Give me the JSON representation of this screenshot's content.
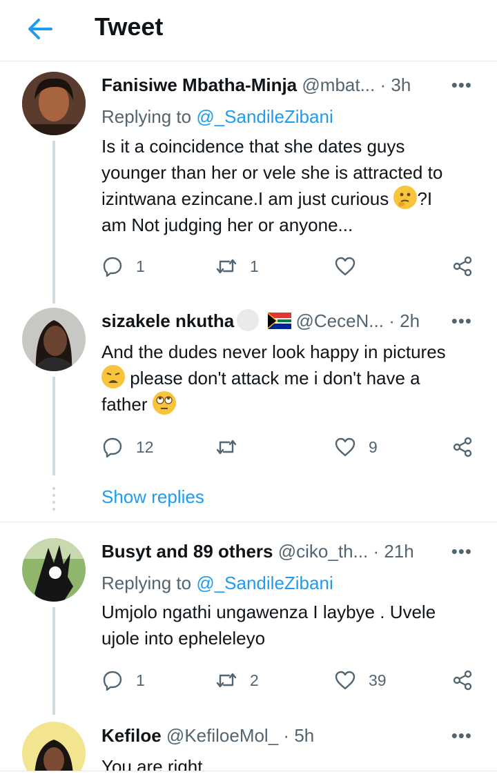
{
  "header": {
    "title": "Tweet"
  },
  "tweets": [
    {
      "name": "Fanisiwe Mbatha-Minja",
      "handle": "@mbat...",
      "time": "3h",
      "replying_prefix": "Replying to ",
      "replying_to": "@_SandileZibani",
      "text_lines": [
        "Is it a coincidence that she dates guys",
        "younger than her or vele she is attracted to",
        "izintwana ezincane.I am just curious",
        "?I",
        "am Not judging her or  anyone..."
      ],
      "replies": "1",
      "retweets": "1",
      "likes": ""
    },
    {
      "name": "sizakele nkutha",
      "handle": "@CeceN...",
      "time": "2h",
      "text_lines": [
        "And the dudes never look happy in pictures",
        " please don't attack me i don't have a",
        "father"
      ],
      "replies": "12",
      "retweets": "",
      "likes": "9"
    },
    {
      "name": "Busyt and 89 others",
      "handle": "@ciko_th...",
      "time": "21h",
      "replying_prefix": "Replying to ",
      "replying_to": "@_SandileZibani",
      "text_lines": [
        "Umjolo ngathi ungawenza I laybye . Uvele",
        "ujole into epheleleyo"
      ],
      "replies": "1",
      "retweets": "2",
      "likes": "39"
    },
    {
      "name": "Kefiloe",
      "handle": "@KefiloeMol_",
      "time": "5h",
      "text_lines": [
        "You are right"
      ]
    }
  ],
  "show_replies": "Show replies",
  "separator": "·",
  "more": "•••",
  "colors": {
    "accent": "#1d9bf0",
    "secondary": "#536471",
    "line": "#cfd9de"
  }
}
